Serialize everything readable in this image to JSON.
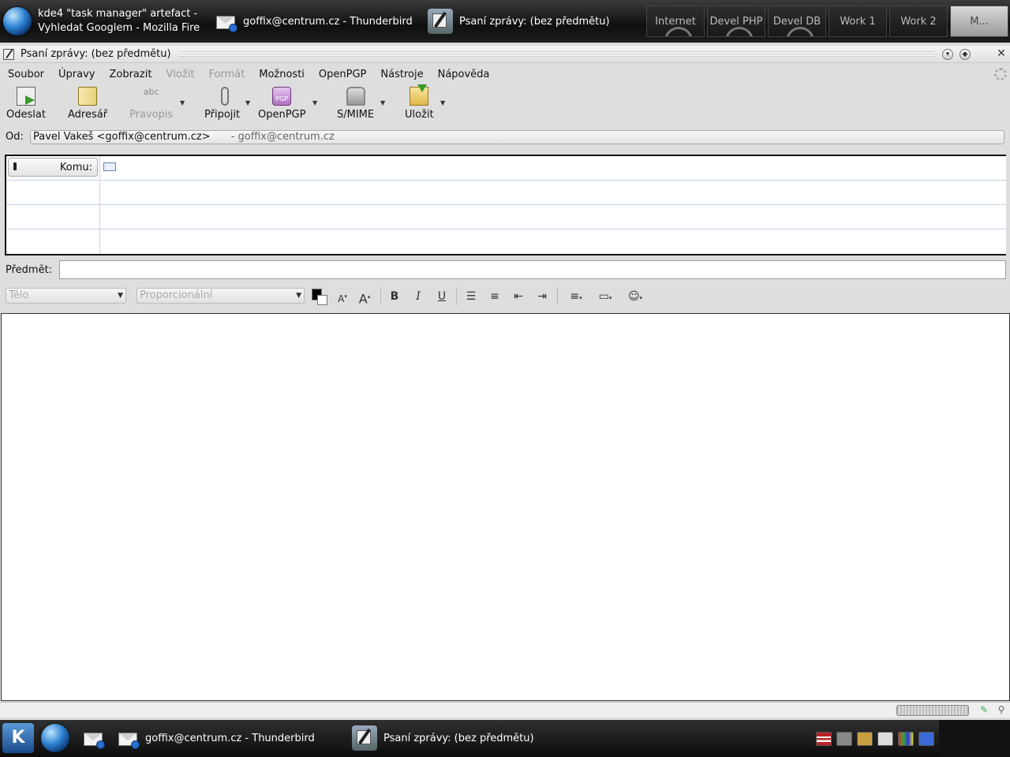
{
  "top_panel": {
    "tasks": [
      {
        "line1": "kde4 \"task manager\" artefact -",
        "line2": "Vyhledat Googlem - Mozilla Fire"
      },
      {
        "label": "goffix@centrum.cz - Thunderbird"
      },
      {
        "label": "Psaní zprávy: (bez předmětu)"
      }
    ],
    "desktops": [
      "Internet",
      "Devel PHP",
      "Devel DB",
      "Work 1",
      "Work 2",
      "M..."
    ]
  },
  "window": {
    "title": "Psaní zprávy: (bez předmětu)",
    "menu": [
      {
        "label": "Soubor",
        "enabled": true
      },
      {
        "label": "Úpravy",
        "enabled": true
      },
      {
        "label": "Zobrazit",
        "enabled": true
      },
      {
        "label": "Vložit",
        "enabled": false
      },
      {
        "label": "Formát",
        "enabled": false
      },
      {
        "label": "Možnosti",
        "enabled": true
      },
      {
        "label": "OpenPGP",
        "enabled": true
      },
      {
        "label": "Nástroje",
        "enabled": true
      },
      {
        "label": "Nápověda",
        "enabled": true
      }
    ],
    "toolbar": {
      "send": "Odeslat",
      "address_book": "Adresář",
      "spelling": "Pravopis",
      "spell_icon_text": "abc",
      "attach": "Připojit",
      "openpgp": "OpenPGP",
      "openpgp_icon_text": "PGP",
      "smime": "S/MIME",
      "save": "Uložit"
    },
    "from": {
      "label": "Od:",
      "identity": "Pavel Vakeš <goffix@centrum.cz>",
      "account": "- goffix@centrum.cz"
    },
    "recipients": {
      "type_label": "Komu:",
      "rows": 4
    },
    "subject": {
      "label": "Předmět:",
      "value": ""
    },
    "format_toolbar": {
      "paragraph_style": "Tělo",
      "font": "Proporcionální",
      "text_color": "#000000",
      "background_color": "#ffffff"
    },
    "body": ""
  },
  "bottom_panel": {
    "tasks": [
      {
        "label": "goffix@centrum.cz - Thunderbird"
      },
      {
        "label": "Psaní zprávy: (bez předmětu)"
      }
    ]
  },
  "colors": {
    "panel_bg": "#1a1a1a",
    "window_bg": "#dedede",
    "accent": "#2a7fd0"
  }
}
